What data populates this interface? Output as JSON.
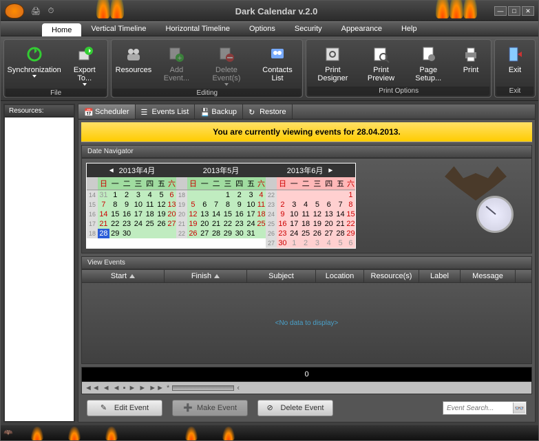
{
  "app_title": "Dark Calendar v.2.0",
  "menus": [
    "Home",
    "Vertical Timeline",
    "Horizontal Timeline",
    "Options",
    "Security",
    "Appearance",
    "Help"
  ],
  "active_menu": "Home",
  "ribbon": {
    "groups": [
      {
        "caption": "File",
        "buttons": [
          {
            "label": "Synchronization",
            "dropdown": true,
            "disabled": false,
            "icon": "sync"
          },
          {
            "label": "Export To...",
            "dropdown": true,
            "disabled": false,
            "icon": "export"
          }
        ]
      },
      {
        "caption": "Editing",
        "buttons": [
          {
            "label": "Resources",
            "disabled": false,
            "icon": "resources"
          },
          {
            "label": "Add Event...",
            "disabled": true,
            "icon": "add"
          },
          {
            "label": "Delete Event(s)",
            "dropdown": true,
            "disabled": true,
            "icon": "delete"
          },
          {
            "label": "Contacts List",
            "disabled": false,
            "icon": "contacts"
          }
        ]
      },
      {
        "caption": "Print Options",
        "buttons": [
          {
            "label": "Print Designer",
            "disabled": false,
            "icon": "printdesign"
          },
          {
            "label": "Print Preview",
            "disabled": false,
            "icon": "preview"
          },
          {
            "label": "Page Setup...",
            "disabled": false,
            "icon": "pagesetup"
          },
          {
            "label": "Print",
            "disabled": false,
            "icon": "print"
          }
        ]
      },
      {
        "caption": "Exit",
        "buttons": [
          {
            "label": "Exit",
            "disabled": false,
            "icon": "exit"
          }
        ]
      }
    ]
  },
  "sidebar": {
    "header": "Resources:"
  },
  "subtabs": [
    "Scheduler",
    "Events List",
    "Backup",
    "Restore"
  ],
  "active_subtab": "Scheduler",
  "banner": "You are currently viewing events for 28.04.2013.",
  "date_navigator_title": "Date Navigator",
  "months": [
    {
      "title": "2013年4月",
      "color": "green",
      "arrow": "left",
      "weeks": [
        [
          14,
          31,
          1,
          2,
          3,
          4,
          5,
          6
        ],
        [
          15,
          7,
          8,
          9,
          10,
          11,
          12,
          13
        ],
        [
          16,
          14,
          15,
          16,
          17,
          18,
          19,
          20
        ],
        [
          17,
          21,
          22,
          23,
          24,
          25,
          26,
          27
        ],
        [
          18,
          28,
          29,
          30,
          "",
          "",
          "",
          ""
        ]
      ],
      "out_first": 1,
      "selected": 28
    },
    {
      "title": "2013年5月",
      "color": "green",
      "weeks": [
        [
          18,
          "",
          "",
          "",
          1,
          2,
          3,
          4
        ],
        [
          19,
          5,
          6,
          7,
          8,
          9,
          10,
          11
        ],
        [
          20,
          12,
          13,
          14,
          15,
          16,
          17,
          18
        ],
        [
          21,
          19,
          20,
          21,
          22,
          23,
          24,
          25
        ],
        [
          22,
          26,
          27,
          28,
          29,
          30,
          31,
          ""
        ]
      ]
    },
    {
      "title": "2013年6月",
      "color": "pink",
      "arrow": "right",
      "weeks": [
        [
          22,
          "",
          "",
          "",
          "",
          "",
          "",
          1
        ],
        [
          23,
          2,
          3,
          4,
          5,
          6,
          7,
          8
        ],
        [
          24,
          9,
          10,
          11,
          12,
          13,
          14,
          15
        ],
        [
          25,
          16,
          17,
          18,
          19,
          20,
          21,
          22
        ],
        [
          26,
          23,
          24,
          25,
          26,
          27,
          28,
          29
        ],
        [
          27,
          30,
          1,
          2,
          3,
          4,
          5,
          6
        ]
      ],
      "out_last": 6
    }
  ],
  "dow": [
    "日",
    "一",
    "二",
    "三",
    "四",
    "五",
    "六"
  ],
  "view_events_title": "View Events",
  "columns": [
    "Start",
    "Finish",
    "Subject",
    "Location",
    "Resource(s)",
    "Label",
    "Message"
  ],
  "no_data": "<No data to display>",
  "counter": "0",
  "footer_buttons": {
    "edit": "Edit Event",
    "make": "Make Event",
    "delete": "Delete Event"
  },
  "search_placeholder": "Event Search..."
}
